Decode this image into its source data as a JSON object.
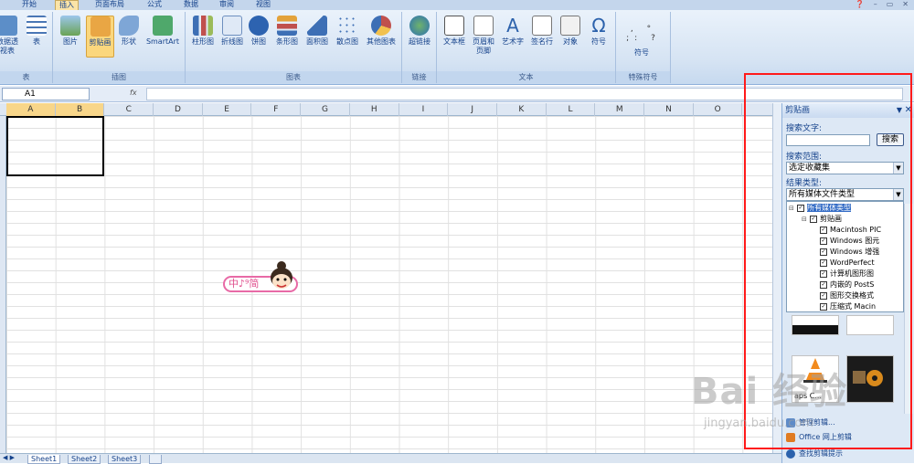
{
  "tabs": [
    "开始",
    "插入",
    "页面布局",
    "公式",
    "数据",
    "审阅",
    "视图"
  ],
  "ribbon": {
    "groups": [
      {
        "label": "表",
        "buttons": [
          "数据透视表",
          "表"
        ]
      },
      {
        "label": "插图",
        "buttons": [
          "图片",
          "剪贴画",
          "形状",
          "SmartArt"
        ]
      },
      {
        "label": "图表",
        "buttons": [
          "柱形图",
          "折线图",
          "饼图",
          "条形图",
          "面积图",
          "散点图",
          "其他图表"
        ]
      },
      {
        "label": "链接",
        "buttons": [
          "超链接"
        ]
      },
      {
        "label": "文本",
        "buttons": [
          "文本框",
          "页眉和页脚",
          "艺术字",
          "签名行",
          "对象",
          "符号"
        ]
      },
      {
        "label": "特殊符号",
        "buttons": [
          "符号"
        ]
      }
    ]
  },
  "namebox": "A1",
  "fx": "fx",
  "columns": [
    "A",
    "B",
    "C",
    "D",
    "E",
    "F",
    "G",
    "H",
    "I",
    "J",
    "K",
    "L",
    "M",
    "N",
    "O"
  ],
  "sheets": [
    "Sheet1",
    "Sheet2",
    "Sheet3"
  ],
  "sticker": "中♪⁹简",
  "pane": {
    "title": "剪贴画",
    "search_label": "搜索文字:",
    "search_button": "搜索",
    "scope_label": "搜索范围:",
    "scope_value": "选定收藏集",
    "type_label": "结果类型:",
    "type_value": "所有媒体文件类型",
    "tree": [
      "所有媒体类型",
      "剪贴画",
      "Macintosh PIC",
      "Windows 图元",
      "Windows 增强",
      "WordPerfect",
      "计算机图形图",
      "内嵌的 PostS",
      "图形交换格式",
      "压缩式 Macin"
    ],
    "thumb_caption": "aps C...",
    "links": [
      "管理剪辑...",
      "Office 网上剪辑",
      "查找剪辑提示"
    ]
  },
  "watermark": "Bai 经验",
  "watermark_url": "jingyan.baidu.com",
  "colors": {
    "accent": "#15428b",
    "highlight": "#ff1a1a",
    "selected": "#fbd77d"
  }
}
